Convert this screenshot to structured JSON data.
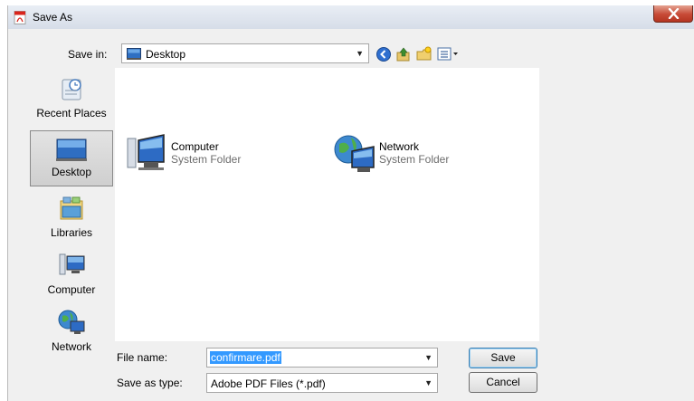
{
  "window": {
    "title": "Save As"
  },
  "save_in": {
    "label": "Save in:",
    "value": "Desktop"
  },
  "places": [
    {
      "label": "Recent Places",
      "icon": "recent-places-icon"
    },
    {
      "label": "Desktop",
      "icon": "desktop-icon",
      "selected": true
    },
    {
      "label": "Libraries",
      "icon": "libraries-icon"
    },
    {
      "label": "Computer",
      "icon": "computer-icon"
    },
    {
      "label": "Network",
      "icon": "network-icon"
    }
  ],
  "files": [
    {
      "name": "Computer",
      "type": "System Folder",
      "icon": "computer-icon"
    },
    {
      "name": "Network",
      "type": "System Folder",
      "icon": "network-icon"
    }
  ],
  "form": {
    "file_name_label": "File name:",
    "file_name_value": "confirmare.pdf",
    "save_type_label": "Save as type:",
    "save_type_value": "Adobe PDF Files (*.pdf)"
  },
  "buttons": {
    "save": "Save",
    "cancel": "Cancel"
  },
  "colors": {
    "selection": "#3399ff",
    "close_button": "#c74a36",
    "pdf_icon": "#d9251d"
  }
}
